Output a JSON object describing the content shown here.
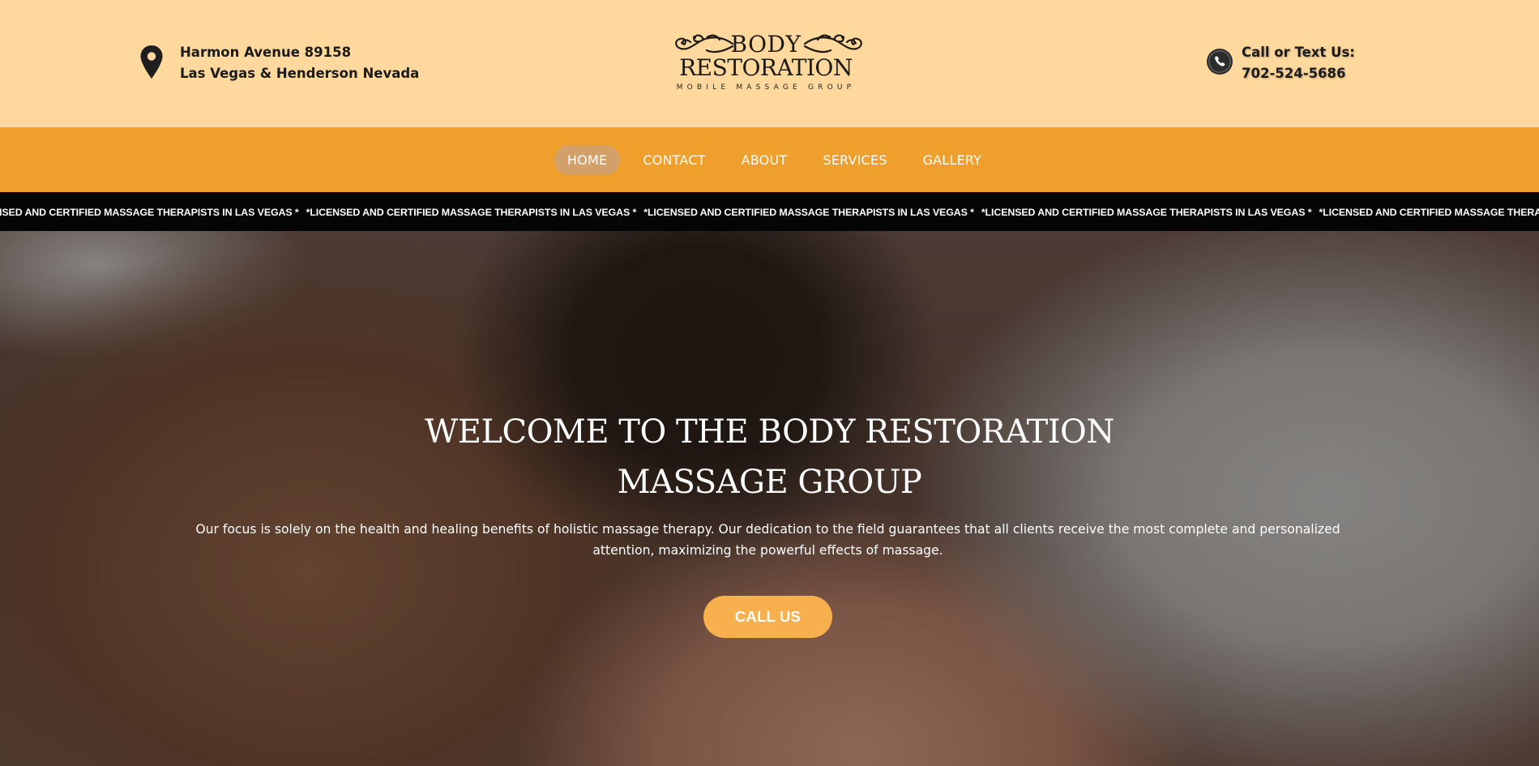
{
  "header": {
    "address_line1": "Harmon Avenue 89158",
    "address_line2": "Las Vegas & Henderson Nevada",
    "logo_line1": "BODY",
    "logo_line2": "RESTORATION",
    "logo_line3": "MOBILE MASSAGE GROUP",
    "phone_label": "Call or Text Us:",
    "phone_number": "702-524-5686"
  },
  "nav": {
    "items": [
      "HOME",
      "CONTACT",
      "ABOUT",
      "SERVICES",
      "GALLERY"
    ],
    "active": "HOME"
  },
  "ticker": {
    "text": "*LICENSED AND CERTIFIED MASSAGE THERAPISTS IN LAS VEGAS *"
  },
  "hero": {
    "title_line1": "WELCOME TO THE BODY RESTORATION",
    "title_line2": "MASSAGE GROUP",
    "description": "Our focus is solely on the health and healing benefits of holistic massage therapy. Our dedication to the field guarantees that all clients receive the most complete and personalized attention, maximizing the powerful effects of massage.",
    "cta_label": "CALL US"
  },
  "colors": {
    "header_bg": "#fed89c",
    "nav_bg": "#ef9f2c",
    "nav_active_bg": "#d4a06a",
    "ticker_bg": "#050505",
    "cta_bg": "#f8b04f"
  },
  "icons": {
    "address": "map-pin-icon",
    "phone": "phone-icon"
  }
}
